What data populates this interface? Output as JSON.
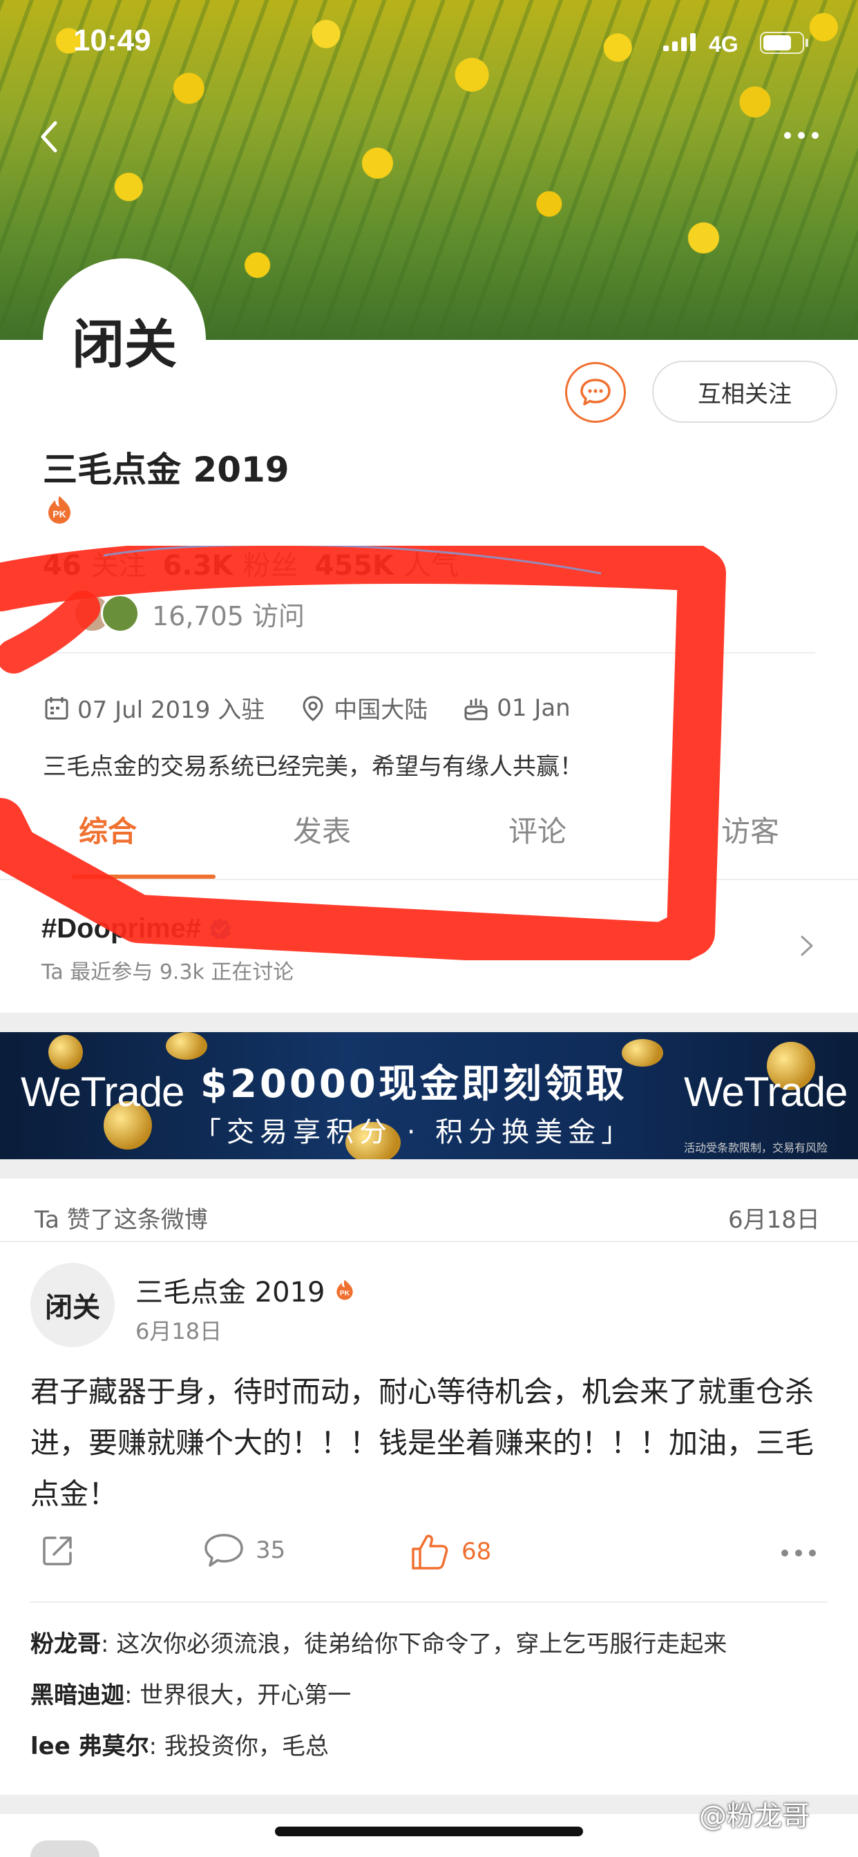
{
  "status_bar": {
    "time": "10:49",
    "network": "4G"
  },
  "profile": {
    "avatar_text": "闭关",
    "follow_button": "互相关注",
    "username": "三毛点金 2019",
    "stats": [
      {
        "value": "46",
        "label": "关注"
      },
      {
        "value": "6.3K",
        "label": "粉丝"
      },
      {
        "value": "455K",
        "label": "人气"
      }
    ],
    "visits": "16,705 访问",
    "joined": "07 Jul 2019 入驻",
    "location": "中国大陆",
    "birthday": "01 Jan",
    "bio": "三毛点金的交易系统已经完美，希望与有缘人共赢！"
  },
  "tabs": [
    {
      "label": "综合",
      "active": true
    },
    {
      "label": "发表",
      "active": false
    },
    {
      "label": "评论",
      "active": false
    },
    {
      "label": "访客",
      "active": false
    }
  ],
  "topic": {
    "title": "#Dooprime#",
    "subtitle": "Ta 最近参与   9.3k 正在讨论"
  },
  "ad": {
    "brand": "WeTrade",
    "title": "$20000现金即刻领取",
    "subtitle": "「交易享积分 · 积分换美金」",
    "fine_print": "活动受条款限制，交易有风险"
  },
  "feed": {
    "liked_label": "Ta 赞了这条微博",
    "liked_date": "6月18日",
    "post": {
      "avatar_text": "闭关",
      "author": "三毛点金 2019",
      "date": "6月18日",
      "text": "君子藏器于身，待时而动，耐心等待机会，机会来了就重仓杀进，要赚就赚个大的！！！钱是坐着赚来的！！！加油，三毛点金！",
      "comment_count": "35",
      "like_count": "68"
    },
    "comments": [
      {
        "user": "粉龙哥",
        "text": "这次你必须流浪，徒弟给你下命令了，穿上乞丐服行走起来"
      },
      {
        "user": "黑暗迪迦",
        "text": "世界很大，开心第一"
      },
      {
        "user": "lee 弗莫尔",
        "text": "我投资你，毛总"
      }
    ]
  },
  "watermark": "@粉龙哥",
  "colors": {
    "accent": "#f07030",
    "annotation": "#ff2a1a"
  }
}
